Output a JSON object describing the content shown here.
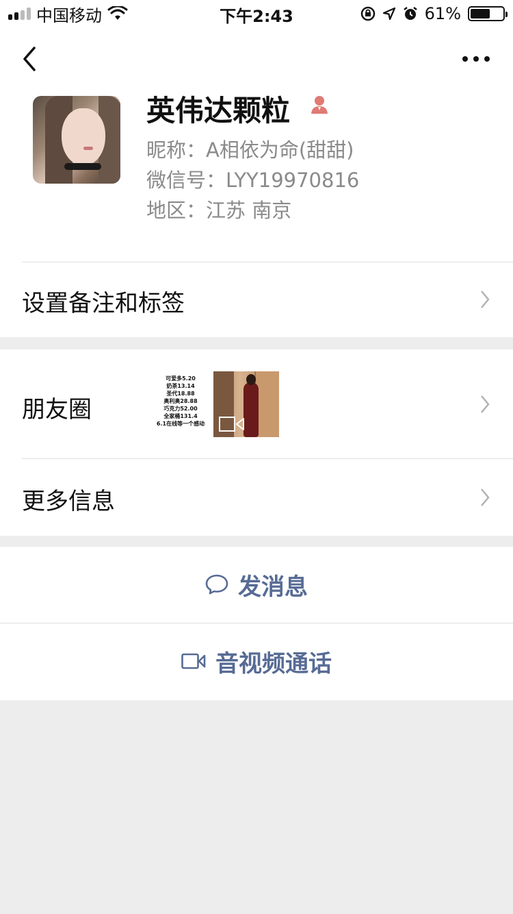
{
  "status_bar": {
    "carrier": "中国移动",
    "time": "下午2:43",
    "battery_percent": "61%",
    "battery_level": 0.61
  },
  "profile": {
    "display_name": "英伟达颗粒",
    "gender_icon": "female-icon",
    "nickname_label": "昵称：",
    "nickname": "A相依为命(甜甜)",
    "wechat_id_label": "微信号：",
    "wechat_id": "LYY19970816",
    "region_label": "地区：",
    "region": "江苏 南京"
  },
  "menu": {
    "remarks_tags": "设置备注和标签",
    "moments": "朋友圈",
    "more_info": "更多信息"
  },
  "moments_thumb_text": [
    "可爱多5.20",
    "奶茶13.14",
    "圣代18.88",
    "奥利奥28.88",
    "巧克力52.00",
    "全家桶131.4",
    "6.1在线等一个感动"
  ],
  "actions": {
    "send_message": "发消息",
    "av_call": "音视频通话"
  },
  "colors": {
    "link_blue": "#576b95",
    "female_icon": "#e07b74",
    "background": "#ededed"
  }
}
